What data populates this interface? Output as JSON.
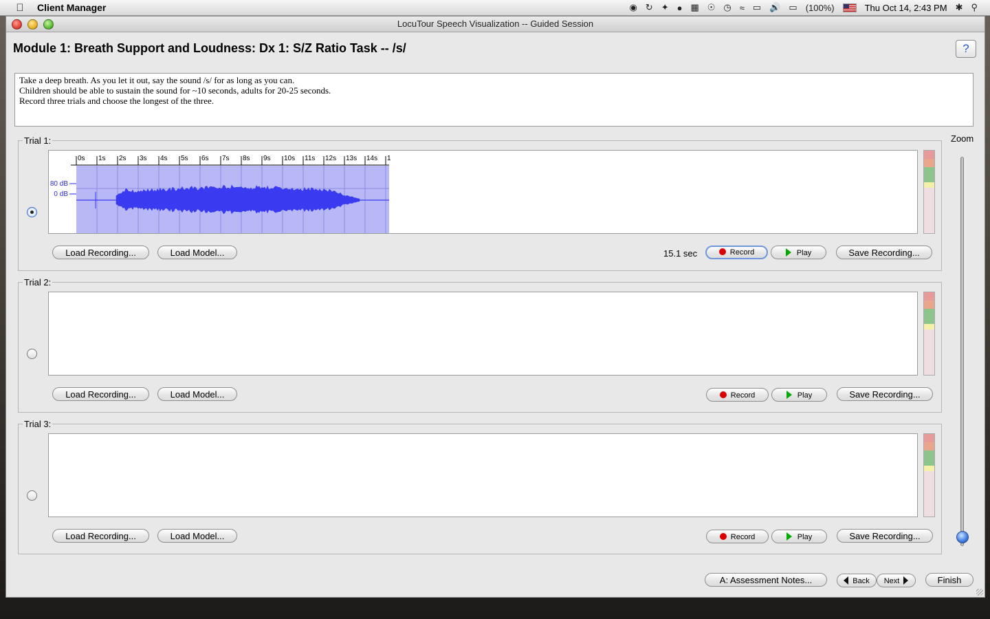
{
  "menubar": {
    "app_name": "Client Manager",
    "battery": "(100%)",
    "clock": "Thu Oct 14,  2:43 PM",
    "status_icons": [
      "evernote-icon",
      "sync-icon",
      "wrench-icon",
      "stoplight-icon",
      "dashboard-icon",
      "accessibility-icon",
      "time-machine-icon",
      "wifi-icon",
      "display-icon",
      "volume-icon",
      "battery-icon",
      "flag-icon",
      "bluetooth-icon",
      "spotlight-icon"
    ]
  },
  "window": {
    "title": "LocuTour Speech Visualization -- Guided Session",
    "heading": "Module 1: Breath Support and Loudness: Dx 1: S/Z Ratio Task -- /s/",
    "help_label": "?"
  },
  "instructions": [
    "Take a deep breath. As you let it out, say the sound /s/ for as long as you can.",
    "Children should be able to sustain the sound for ~10 seconds, adults for 20-25 seconds.",
    "Record three trials and choose the longest of the three."
  ],
  "trials": [
    {
      "title": "Trial 1:",
      "selected": true,
      "duration": "15.1 sec",
      "load_recording": "Load Recording...",
      "load_model": "Load Model...",
      "record": "Record",
      "play": "Play",
      "save_recording": "Save Recording...",
      "waveform": {
        "time_ticks": [
          "0s",
          "1s",
          "2s",
          "3s",
          "4s",
          "5s",
          "6s",
          "7s",
          "8s",
          "9s",
          "10s",
          "11s",
          "12s",
          "13s",
          "14s",
          "1"
        ],
        "db_labels": [
          "80 dB",
          "0 dB"
        ],
        "fill_color": "#b8b8f7",
        "wave_color": "#3a3af0"
      }
    },
    {
      "title": "Trial 2:",
      "selected": false,
      "duration": "",
      "load_recording": "Load Recording...",
      "load_model": "Load Model...",
      "record": "Record",
      "play": "Play",
      "save_recording": "Save Recording..."
    },
    {
      "title": "Trial 3:",
      "selected": false,
      "duration": "",
      "load_recording": "Load Recording...",
      "load_model": "Load Model...",
      "record": "Record",
      "play": "Play",
      "save_recording": "Save Recording..."
    }
  ],
  "meter_colors": [
    "#e89a9a",
    "#eaa58d",
    "#8cc48c",
    "#f4f0a8",
    "#f0dde2"
  ],
  "zoom": {
    "label": "Zoom",
    "level": 0
  },
  "footer": {
    "assessment_notes": "A: Assessment Notes...",
    "back": "Back",
    "next": "Next",
    "finish": "Finish"
  }
}
